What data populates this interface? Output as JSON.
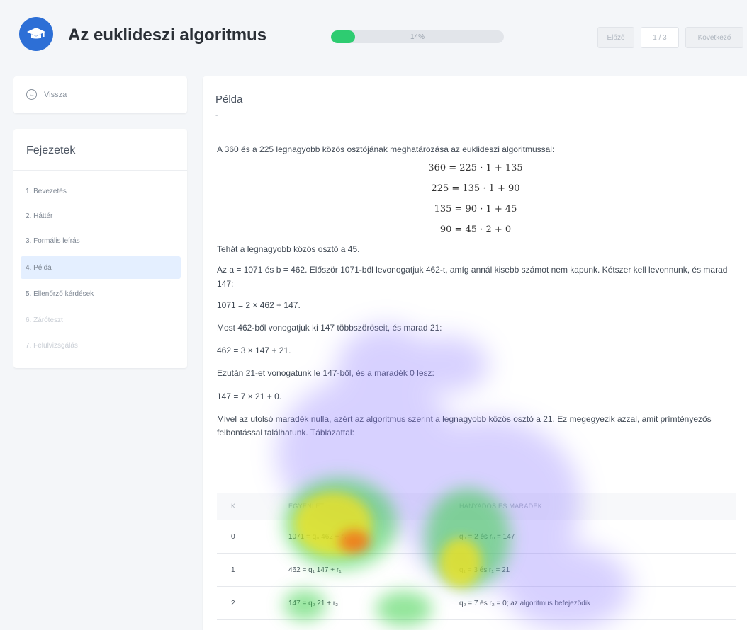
{
  "header": {
    "title": "Az euklideszi algoritmus",
    "progress_label": "14%",
    "progress_value": 0.14,
    "prev_label": "Előző",
    "page_indicator": "1 / 3",
    "next_label": "Következő"
  },
  "sidebar": {
    "back_label": "Vissza",
    "chapters_title": "Fejezetek",
    "items": [
      {
        "label": "1. Bevezetés"
      },
      {
        "label": "2. Háttér"
      },
      {
        "label": "3. Formális leírás"
      },
      {
        "label": "4. Példa"
      },
      {
        "label": "5. Ellenőrző kérdések"
      },
      {
        "label": "6. Záróteszt"
      },
      {
        "label": "7. Felülvizsgálás"
      }
    ],
    "active_index": 3
  },
  "main": {
    "section_title": "Példa",
    "section_subtitle": "-",
    "intro": "A 360 és a 225 legnagyobb közös osztójának meghatározása az euklideszi algoritmussal:",
    "equations": [
      "360 = 225 · 1 + 135",
      "225 = 135 · 1 + 90",
      "135 = 90 · 1 + 45",
      "90 = 45 · 2 + 0"
    ],
    "p1": "Tehát a legnagyobb közös osztó a 45.",
    "p2": "Az a = 1071 és b = 462. Először 1071-ből levonogatjuk 462-t, amíg annál kisebb számot nem kapunk. Kétszer kell levonnunk, és marad 147:",
    "p3": "1071 = 2 × 462 + 147.",
    "p4": "Most 462-ből vonogatjuk ki 147 többszöröseit, és marad 21:",
    "p5": "462 = 3 × 147 + 21.",
    "p6": "Ezután 21-et vonogatunk le 147-ből, és a maradék 0 lesz:",
    "p7": "147 = 7 × 21 + 0.",
    "p8": "Mivel az utolsó maradék nulla, azért az algoritmus szerint a legnagyobb közös osztó a 21. Ez megegyezik azzal, amit prímtényezős felbontással találhatunk. Táblázattal:",
    "table": {
      "headers": [
        "K",
        "EGYENLET",
        "HÁNYADOS ÉS MARADÉK"
      ],
      "rows": [
        [
          "0",
          "1071 = q₀ 462 + r₀",
          "q₀ = 2 és r₀ = 147"
        ],
        [
          "1",
          "462 = q₁ 147 + r₁",
          "q₁ = 3 és r₁ = 21"
        ],
        [
          "2",
          "147 = q₂ 21 + r₂",
          "q₂ = 7 és r₂ = 0; az algoritmus befejeződik"
        ]
      ]
    }
  }
}
